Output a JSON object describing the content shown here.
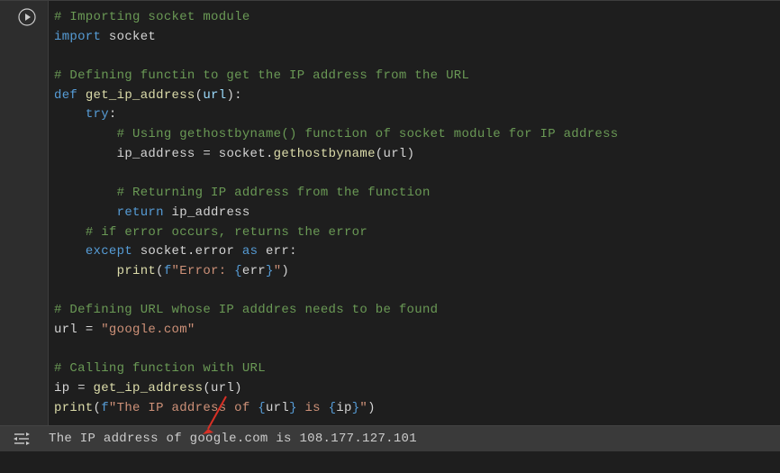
{
  "code": {
    "l1": "# Importing socket module",
    "l2a": "import",
    "l2b": "socket",
    "l3": "",
    "l4": "# Defining functin to get the IP address from the URL",
    "l5a": "def",
    "l5b": "get_ip_address",
    "l5c": "url",
    "l6a": "try",
    "l7": "# Using gethostbyname() function of socket module for IP address",
    "l8a": "ip_address",
    "l8b": "socket",
    "l8c": "gethostbyname",
    "l8d": "url",
    "l9": "",
    "l10": "# Returning IP address from the function",
    "l11a": "return",
    "l11b": "ip_address",
    "l12": "# if error occurs, returns the error",
    "l13a": "except",
    "l13b": "socket",
    "l13c": "error",
    "l13d": "as",
    "l13e": "err",
    "l14a": "print",
    "l14b": "f",
    "l14c": "\"Error: ",
    "l14d": "err",
    "l14e": "\"",
    "l15": "",
    "l16": "# Defining URL whose IP adddres needs to be found",
    "l17a": "url",
    "l17b": "\"google.com\"",
    "l18": "",
    "l19": "# Calling function with URL",
    "l20a": "ip",
    "l20b": "get_ip_address",
    "l20c": "url",
    "l21a": "print",
    "l21b": "f",
    "l21c": "\"The IP address of ",
    "l21d": "url",
    "l21e": " is ",
    "l21f": "ip",
    "l21g": "\""
  },
  "output": {
    "text": "The IP address of google.com is 108.177.127.101"
  }
}
